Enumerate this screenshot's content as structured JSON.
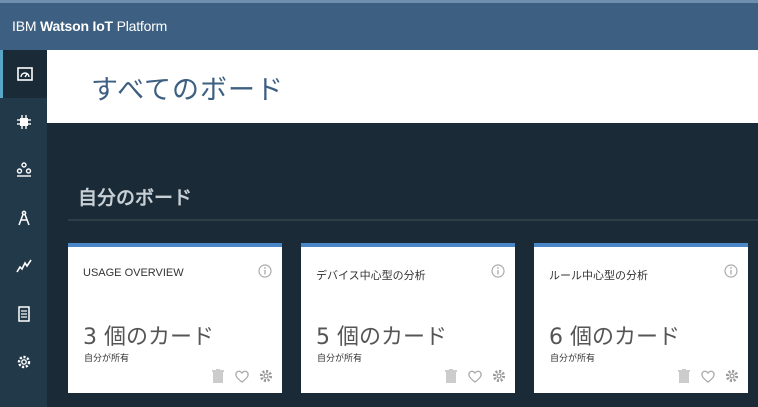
{
  "app": {
    "brand_part1": "IBM ",
    "brand_part2": "Watson ",
    "brand_part3": "IoT",
    "brand_part4": " Platform"
  },
  "sidebar": {
    "items": [
      {
        "icon": "dashboard-icon",
        "active": true
      },
      {
        "icon": "chip-icon",
        "active": false
      },
      {
        "icon": "members-icon",
        "active": false
      },
      {
        "icon": "compass-icon",
        "active": false
      },
      {
        "icon": "analytics-icon",
        "active": false
      },
      {
        "icon": "document-icon",
        "active": false
      },
      {
        "icon": "gear-icon",
        "active": false
      }
    ]
  },
  "header": {
    "title": "すべてのボード"
  },
  "section": {
    "title": "自分のボード"
  },
  "cards": [
    {
      "title": "USAGE OVERVIEW",
      "count": "3 個のカード",
      "owner": "自分が所有"
    },
    {
      "title": "デバイス中心型の分析",
      "count": "5 個のカード",
      "owner": "自分が所有"
    },
    {
      "title": "ルール中心型の分析",
      "count": "6 個のカード",
      "owner": "自分が所有"
    }
  ],
  "colors": {
    "topbar": "#3d5f82",
    "sidebar": "#22394a",
    "background": "#1a2b37",
    "card_accent": "#4b87c8"
  }
}
